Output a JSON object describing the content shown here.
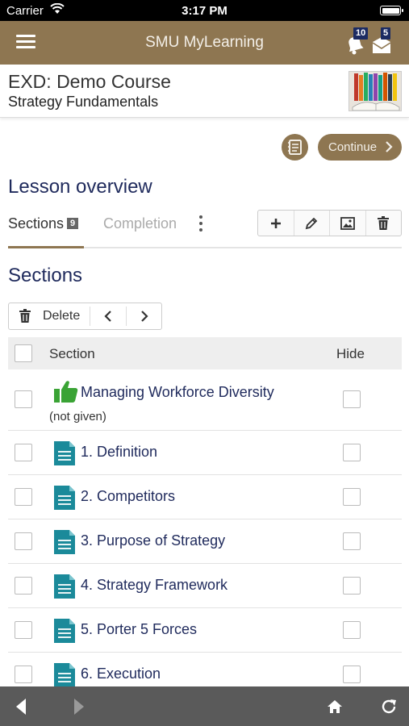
{
  "status_bar": {
    "carrier": "Carrier",
    "time": "3:17 PM"
  },
  "header": {
    "title": "SMU MyLearning",
    "notifications_count": "10",
    "messages_count": "5"
  },
  "course": {
    "title": "EXD: Demo Course",
    "subtitle": "Strategy Fundamentals"
  },
  "actions": {
    "continue_label": "Continue"
  },
  "lesson": {
    "heading": "Lesson overview",
    "tabs": [
      {
        "label": "Sections",
        "count": "9"
      },
      {
        "label": "Completion"
      }
    ]
  },
  "sections": {
    "heading": "Sections",
    "toolbar": {
      "delete_label": "Delete"
    },
    "table": {
      "col_section": "Section",
      "col_hide": "Hide",
      "rows": [
        {
          "title": "Managing Workforce Diversity",
          "subtitle": "(not given)",
          "icon": "thumbs-up-icon"
        },
        {
          "title": "1. Definition",
          "icon": "document-icon"
        },
        {
          "title": "2. Competitors",
          "icon": "document-icon"
        },
        {
          "title": "3. Purpose of Strategy",
          "icon": "document-icon"
        },
        {
          "title": "4. Strategy Framework",
          "icon": "document-icon"
        },
        {
          "title": "5. Porter 5 Forces",
          "icon": "document-icon"
        },
        {
          "title": "6. Execution",
          "icon": "document-icon"
        }
      ]
    }
  },
  "colors": {
    "brand": "#8e7651",
    "heading": "#1f2a5c",
    "badge": "#1c2b63",
    "doc_icon": "#1b8a9a",
    "thumb_icon": "#3aa335",
    "bottom_bar": "#5a5a5a"
  }
}
